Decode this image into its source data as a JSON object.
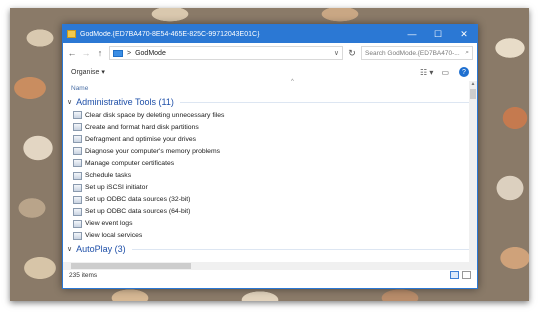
{
  "window": {
    "title": "GodMode.{ED7BA470-8E54-465E-825C-99712043E01C}",
    "controls": {
      "minimize": "—",
      "maximize": "☐",
      "close": "✕"
    }
  },
  "address": {
    "back": "←",
    "forward": "→",
    "up": "↑",
    "separator": ">",
    "crumb": "GodMode",
    "dropdown": "∨",
    "refresh": "↻",
    "search_placeholder": "Search GodMode.{ED7BA470-...",
    "search_icon": "⌕"
  },
  "toolbar": {
    "organise": "Organise ▾",
    "view_icon": "☷ ▾",
    "pane_icon": "▭",
    "help": "?"
  },
  "list": {
    "column_name": "Name",
    "sort_indicator": "^",
    "groups": [
      {
        "label": "Administrative Tools (11)",
        "items": [
          "Clear disk space by deleting unnecessary files",
          "Create and format hard disk partitions",
          "Defragment and optimise your drives",
          "Diagnose your computer's memory problems",
          "Manage computer certificates",
          "Schedule tasks",
          "Set up iSCSI initiator",
          "Set up ODBC data sources (32-bit)",
          "Set up ODBC data sources (64-bit)",
          "View event logs",
          "View local services"
        ]
      },
      {
        "label": "AutoPlay (3)"
      }
    ]
  },
  "status": {
    "count": "235 items"
  }
}
